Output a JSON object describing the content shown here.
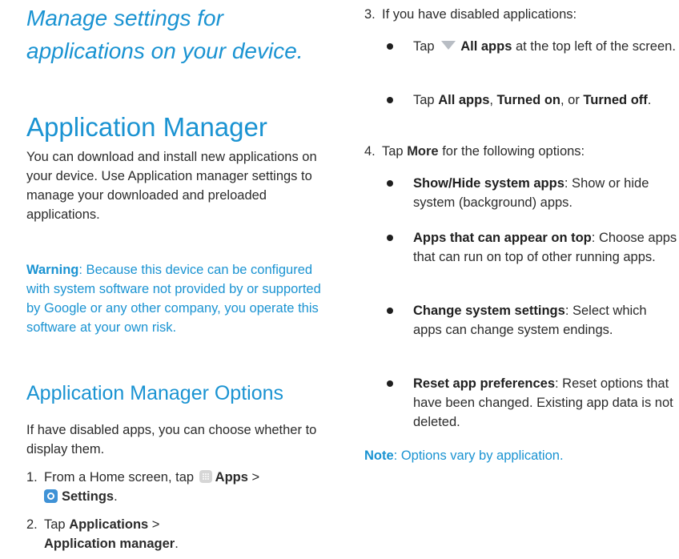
{
  "tagline": "Manage settings for applications on your device.",
  "section": {
    "title": "Application Manager",
    "intro": "You can download and install new applications on your device. Use Application manager settings to manage your downloaded and preloaded applications.",
    "warning_label": "Warning",
    "warning_text": ": Because this device can be configured with system software not provided by or supported by Google or any other company, you operate this software at your own risk."
  },
  "options": {
    "title": "Application Manager Options",
    "intro": "If have disabled apps, you can choose whether to display them.",
    "step1": {
      "num": "1.",
      "pre": "From a Home screen, tap ",
      "apps": "Apps",
      "sep": " >",
      "settings": "Settings",
      "end": "."
    },
    "step2": {
      "num": "2.",
      "pre": "Tap ",
      "b1": "Applications",
      "sep": " >",
      "b2": "Application manager",
      "end": "."
    },
    "step3": {
      "num": "3.",
      "text": "If you have disabled applications:"
    },
    "step3_b1": {
      "pre": "Tap ",
      "bold": "All apps",
      "rest": " at the top left of the screen."
    },
    "step3_b2": {
      "pre": "Tap ",
      "b1": "All apps",
      "m1": ", ",
      "b2": "Turned on",
      "m2": ", or ",
      "b3": "Turned off",
      "end": "."
    },
    "step4": {
      "num": "4.",
      "pre": "Tap ",
      "bold": "More",
      "rest": " for the following options:"
    },
    "step4_items": [
      {
        "bold": "Show/Hide system apps",
        "rest": ": Show or hide system (background) apps."
      },
      {
        "bold": "Apps that can appear on top",
        "rest": ": Choose apps that can run on top of other running apps."
      },
      {
        "bold": "Change system settings",
        "rest": ": Select which apps can change system endings."
      },
      {
        "bold": "Reset app preferences",
        "rest": ": Reset options that have been changed. Existing app data is not deleted."
      }
    ]
  },
  "note": {
    "label": "Note",
    "text": ": Options vary by application."
  },
  "icons": {
    "apps": "apps-grid-icon",
    "settings": "settings-gear-icon",
    "dropdown": "dropdown-triangle-icon",
    "bullet": "bullet-dot"
  },
  "colors": {
    "accent": "#1a93d2",
    "text": "#2b2b2b"
  }
}
